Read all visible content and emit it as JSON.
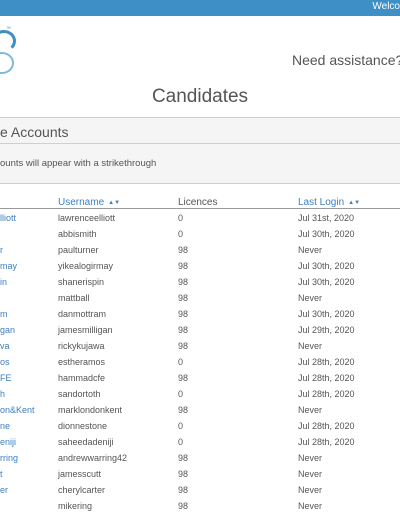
{
  "topbar": {
    "welcome": "Welco"
  },
  "header": {
    "assistance": "Need assistance? D",
    "page_title": "Candidates"
  },
  "panel": {
    "title": "e Accounts",
    "note": "ounts will appear with a strikethrough"
  },
  "table": {
    "columns": [
      {
        "label": "Username",
        "sortable": true
      },
      {
        "label": "Licences",
        "sortable": false
      },
      {
        "label": "Last Login",
        "sortable": true
      }
    ],
    "rows": [
      {
        "name": "lliott",
        "username": "lawrenceelliott",
        "licences": "0",
        "last_login": "Jul 31st, 2020"
      },
      {
        "name": "",
        "username": "abbismith",
        "licences": "0",
        "last_login": "Jul 30th, 2020"
      },
      {
        "name": "r",
        "username": "paulturner",
        "licences": "98",
        "last_login": "Never"
      },
      {
        "name": "may",
        "username": "yikealogirmay",
        "licences": "98",
        "last_login": "Jul 30th, 2020"
      },
      {
        "name": "in",
        "username": "shanerispin",
        "licences": "98",
        "last_login": "Jul 30th, 2020"
      },
      {
        "name": "",
        "username": "mattball",
        "licences": "98",
        "last_login": "Never"
      },
      {
        "name": "m",
        "username": "danmottram",
        "licences": "98",
        "last_login": "Jul 30th, 2020"
      },
      {
        "name": "gan",
        "username": "jamesmilligan",
        "licences": "98",
        "last_login": "Jul 29th, 2020"
      },
      {
        "name": "va",
        "username": "rickykujawa",
        "licences": "98",
        "last_login": "Never"
      },
      {
        "name": "os",
        "username": "estheramos",
        "licences": "0",
        "last_login": "Jul 28th, 2020"
      },
      {
        "name": "FE",
        "username": "hammadcfe",
        "licences": "98",
        "last_login": "Jul 28th, 2020"
      },
      {
        "name": "h",
        "username": "sandortoth",
        "licences": "0",
        "last_login": "Jul 28th, 2020"
      },
      {
        "name": "on&Kent",
        "username": "marklondonkent",
        "licences": "98",
        "last_login": "Never"
      },
      {
        "name": "ne",
        "username": "dionnestone",
        "licences": "0",
        "last_login": "Jul 28th, 2020"
      },
      {
        "name": "eniji",
        "username": "saheedadeniji",
        "licences": "0",
        "last_login": "Jul 28th, 2020"
      },
      {
        "name": "rring",
        "username": "andrewwarring42",
        "licences": "98",
        "last_login": "Never"
      },
      {
        "name": "t",
        "username": "jamesscutt",
        "licences": "98",
        "last_login": "Never"
      },
      {
        "name": "er",
        "username": "cherylcarter",
        "licences": "98",
        "last_login": "Never"
      },
      {
        "name": "",
        "username": "mikering",
        "licences": "98",
        "last_login": "Never"
      }
    ]
  },
  "colors": {
    "brand_blue": "#3d8fc6",
    "link_blue": "#3d7fc1",
    "text_gray": "#555555"
  },
  "icons": {
    "sort": "sort-arrows-icon",
    "logo": "brand-logo-icon"
  }
}
